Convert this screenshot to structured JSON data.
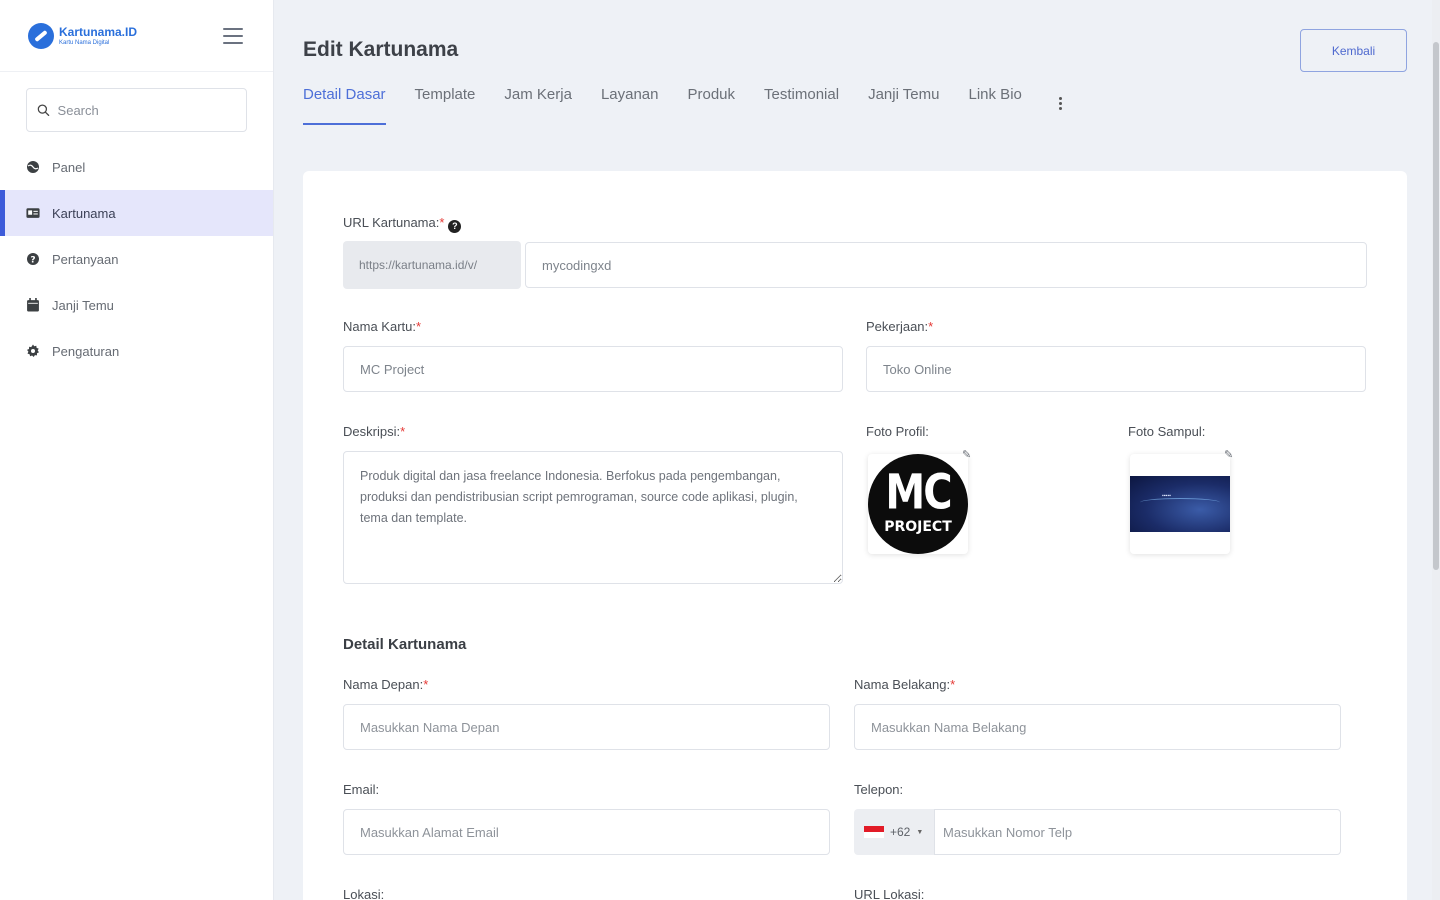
{
  "brand": {
    "title": "Kartunama.ID",
    "subtitle": "Kartu Nama Digital"
  },
  "search": {
    "placeholder": "Search"
  },
  "sidebar": {
    "items": [
      {
        "label": "Panel",
        "icon": "globe-icon",
        "active": false
      },
      {
        "label": "Kartunama",
        "icon": "id-card-icon",
        "active": true
      },
      {
        "label": "Pertanyaan",
        "icon": "question-circle-icon",
        "active": false
      },
      {
        "label": "Janji Temu",
        "icon": "calendar-icon",
        "active": false
      },
      {
        "label": "Pengaturan",
        "icon": "gear-icon",
        "active": false
      }
    ]
  },
  "header": {
    "title": "Edit Kartunama",
    "back_label": "Kembali"
  },
  "tabs": [
    "Detail Dasar",
    "Template",
    "Jam Kerja",
    "Layanan",
    "Produk",
    "Testimonial",
    "Janji Temu",
    "Link Bio"
  ],
  "active_tab": "Detail Dasar",
  "form": {
    "url_label": "URL Kartunama:",
    "url_prefix": "https://kartunama.id/v/",
    "url_value": "mycodingxd",
    "card_name_label": "Nama Kartu:",
    "card_name_value": "MC Project",
    "job_label": "Pekerjaan:",
    "job_value": "Toko Online",
    "desc_label": "Deskripsi:",
    "desc_value": "Produk digital dan jasa freelance Indonesia. Berfokus pada pengembangan, produksi dan pendistribusian script pemrograman, source code aplikasi, plugin, tema dan template.",
    "profile_photo_label": "Foto Profil:",
    "profile_logo_top": "MC",
    "profile_logo_bottom": "PROJECT",
    "cover_photo_label": "Foto Sampul:",
    "section_title": "Detail Kartunama",
    "first_name_label": "Nama Depan:",
    "first_name_placeholder": "Masukkan Nama Depan",
    "last_name_label": "Nama Belakang:",
    "last_name_placeholder": "Masukkan Nama Belakang",
    "email_label": "Email:",
    "email_placeholder": "Masukkan Alamat Email",
    "phone_label": "Telepon:",
    "phone_code": "+62",
    "phone_placeholder": "Masukkan Nomor Telp",
    "location_label": "Lokasi:",
    "location_url_label": "URL Lokasi:",
    "required_mark": "*"
  },
  "colors": {
    "accent": "#4d6fd8",
    "active_nav_bg": "#e5e6fb",
    "required": "#e53935",
    "page_bg": "#eef1f6"
  }
}
